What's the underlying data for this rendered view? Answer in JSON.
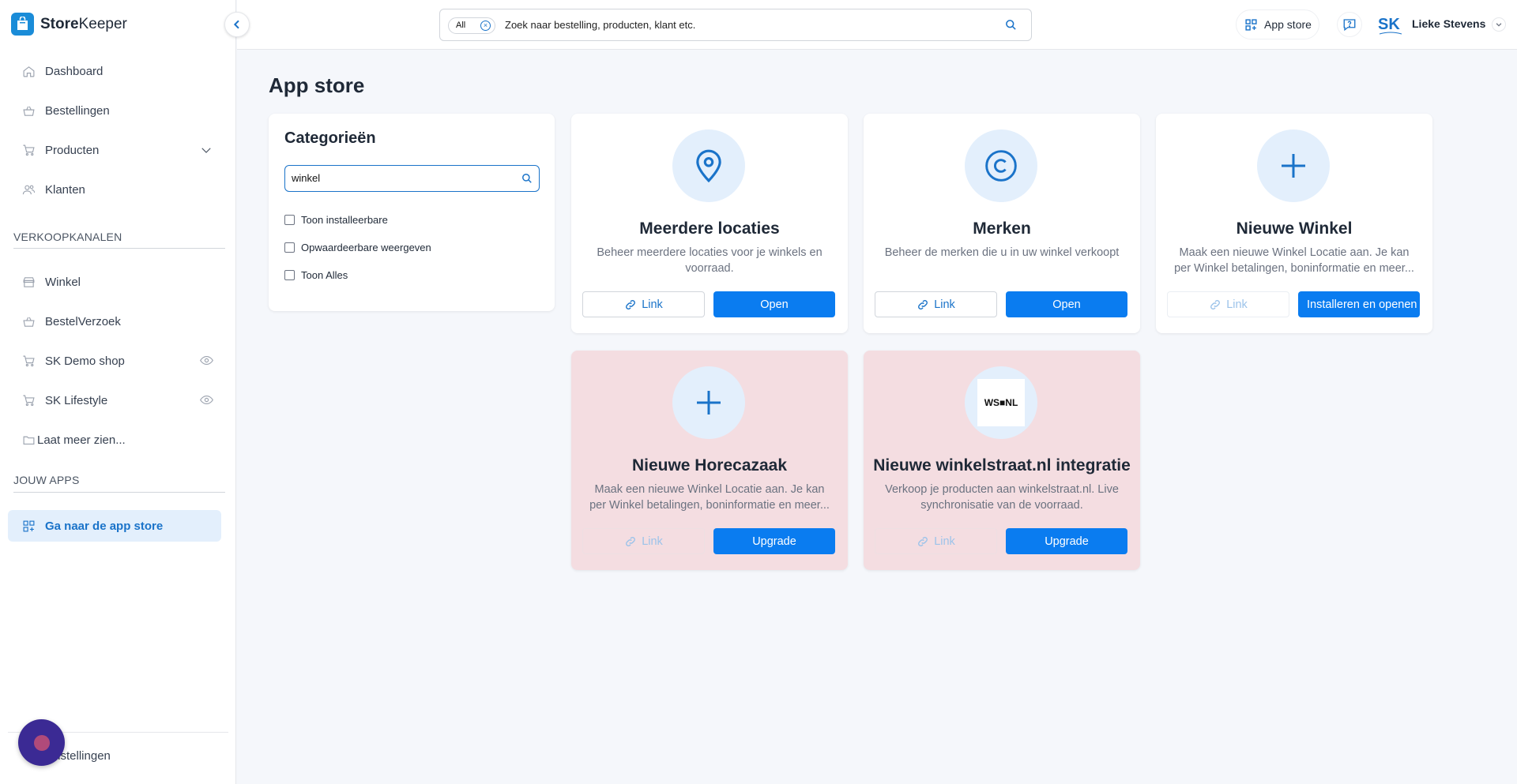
{
  "app": {
    "brand_bold": "Store",
    "brand_light": "Keeper"
  },
  "sidebar": {
    "items": [
      {
        "label": "Dashboard",
        "icon": "home-icon"
      },
      {
        "label": "Bestellingen",
        "icon": "basket-icon"
      },
      {
        "label": "Producten",
        "icon": "cart-icon"
      },
      {
        "label": "Klanten",
        "icon": "users-icon"
      }
    ],
    "section_sales": "VERKOOPKANALEN",
    "sales_items": [
      {
        "label": "Winkel",
        "icon": "store-icon"
      },
      {
        "label": "BestelVerzoek",
        "icon": "basket-icon"
      },
      {
        "label": "SK Demo shop",
        "icon": "cart-icon"
      },
      {
        "label": "SK Lifestyle",
        "icon": "cart-icon"
      }
    ],
    "show_more": "Laat meer zien...",
    "section_apps": "JOUW APPS",
    "apps_item": "Ga naar de app store",
    "settings": "Instellingen"
  },
  "header": {
    "search_scope": "All",
    "search_placeholder": "Zoek naar bestelling, producten, klant etc.",
    "appstore_label": "App store",
    "user_name": "Lieke Stevens",
    "avatar_text": "SK"
  },
  "main": {
    "page_title": "App store",
    "categories": {
      "title": "Categorieën",
      "search_value": "winkel",
      "options": [
        "Toon installeerbare",
        "Opwaardeerbare weergeven",
        "Toon Alles"
      ]
    },
    "cards": [
      {
        "title": "Meerdere locaties",
        "desc": "Beheer meerdere locaties voor je winkels en voorraad.",
        "link": "Link",
        "action": "Open",
        "icon": "map-pin-icon",
        "link_enabled": true,
        "highlight": false
      },
      {
        "title": "Merken",
        "desc": "Beheer de merken die u in uw winkel verkoopt",
        "link": "Link",
        "action": "Open",
        "icon": "copyright-icon",
        "link_enabled": true,
        "highlight": false
      },
      {
        "title": "Nieuwe Winkel",
        "desc": "Maak een nieuwe Winkel Locatie aan. Je kan per Winkel betalingen, boninformatie en meer...",
        "link": "Link",
        "action": "Installeren en openen",
        "icon": "plus-icon",
        "link_enabled": false,
        "highlight": false
      },
      {
        "title": "Nieuwe Horecazaak",
        "desc": "Maak een nieuwe Winkel Locatie aan. Je kan per Winkel betalingen, boninformatie en meer...",
        "link": "Link",
        "action": "Upgrade",
        "icon": "plus-icon",
        "link_enabled": false,
        "highlight": true
      },
      {
        "title": "Nieuwe winkelstraat.nl integratie",
        "desc": "Verkoop je producten aan winkelstraat.nl. Live synchronisatie van de voorraad.",
        "link": "Link",
        "action": "Upgrade",
        "icon": "wsnl-logo-icon",
        "logo_text": "WS■NL",
        "link_enabled": false,
        "highlight": true
      }
    ]
  },
  "colors": {
    "primary": "#0a7cf0",
    "accent_text": "#1a73c9",
    "active_bg": "#e3effc",
    "upgrade_card_bg": "#f4dde1"
  }
}
